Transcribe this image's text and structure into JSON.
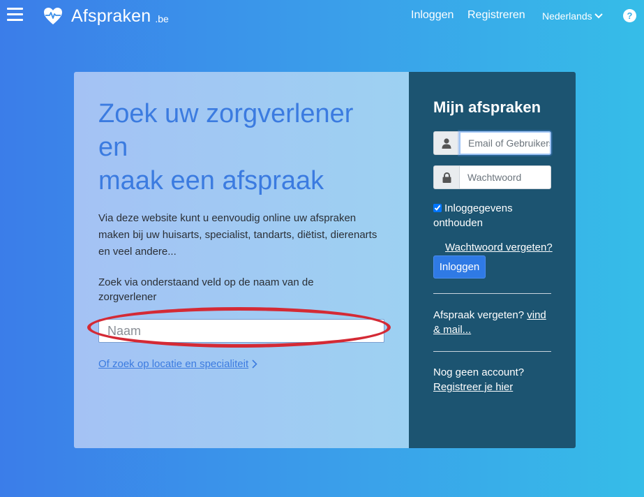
{
  "navbar": {
    "brand_name": "Afspraken",
    "brand_tld": ".be",
    "login_label": "Inloggen",
    "register_label": "Registreren",
    "language_label": "Nederlands",
    "help_label": "?"
  },
  "search_section": {
    "headline_lines": [
      "Zoek uw zorgverlener",
      "en",
      "maak een afspraak"
    ],
    "intro_text": "Via deze website kunt u eenvoudig online uw afspraken maken bij uw huisarts, specialist, tandarts, diëtist, dierenarts en veel andere...",
    "hint_text": "Zoek via onderstaand veld op de naam van de zorgverlener",
    "name_placeholder": "Naam",
    "name_value": "",
    "alt_search_label": "Of zoek op locatie en specialiteit"
  },
  "login_panel": {
    "title": "Mijn afspraken",
    "email_placeholder": "Email of Gebruikersnaam",
    "password_placeholder": "Wachtwoord",
    "remember_label": "Inloggegevens onthouden",
    "remember_checked": true,
    "forgot_password_label": "Wachtwoord vergeten?",
    "login_button_label": "Inloggen",
    "forgot_appointment_text": "Afspraak vergeten?",
    "forgot_appointment_link": "vind & mail...",
    "no_account_text": "Nog geen account?",
    "register_link": "Registreer je hier"
  },
  "colors": {
    "background_start": "#3b7de9",
    "background_end": "#36bde8",
    "panel_dark": "#1c5471",
    "accent_blue": "#2f7ae5",
    "highlight_ring": "#d42a35"
  }
}
